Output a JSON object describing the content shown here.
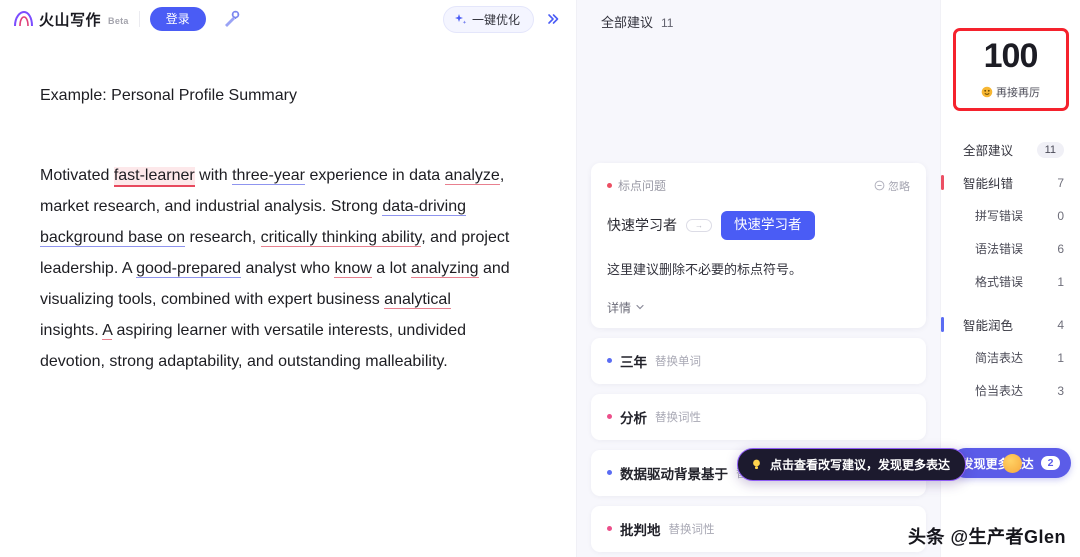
{
  "topbar": {
    "brand_name": "火山写作",
    "beta_label": "Beta",
    "login_label": "登录",
    "magic_icon": "magic-wand-icon",
    "optimize_label": "一键优化",
    "optimize_icon": "sparkle-icon",
    "collapse_icon": "double-chevron-right-icon"
  },
  "editor": {
    "title": "Example: Personal Profile Summary",
    "paragraph_parts": [
      {
        "text": "Motivated ",
        "mark": "none"
      },
      {
        "text": "fast-learner",
        "mark": "error-highlight"
      },
      {
        "text": " with ",
        "mark": "none"
      },
      {
        "text": "three-year",
        "mark": "style"
      },
      {
        "text": " experience in data ",
        "mark": "none"
      },
      {
        "text": "analyze",
        "mark": "error"
      },
      {
        "text": ", market research, and industrial analysis. Strong ",
        "mark": "none"
      },
      {
        "text": "data-driving background base on",
        "mark": "style"
      },
      {
        "text": " research, ",
        "mark": "none"
      },
      {
        "text": "critically thinking ability",
        "mark": "error"
      },
      {
        "text": ", and project leadership. A ",
        "mark": "none"
      },
      {
        "text": "good-prepared",
        "mark": "style"
      },
      {
        "text": " analyst who ",
        "mark": "none"
      },
      {
        "text": "know",
        "mark": "error"
      },
      {
        "text": " a lot ",
        "mark": "none"
      },
      {
        "text": "analyzing",
        "mark": "error"
      },
      {
        "text": " and visualizing tools, combined with expert business ",
        "mark": "none"
      },
      {
        "text": "analytical",
        "mark": "error"
      },
      {
        "text": " insights. ",
        "mark": "none"
      },
      {
        "text": "A",
        "mark": "error"
      },
      {
        "text": " aspiring learner with versatile interests, undivided devotion, strong adaptability, and outstanding malleability.",
        "mark": "none"
      }
    ]
  },
  "suggestions_panel": {
    "header_label": "全部建议",
    "header_count": "11",
    "card": {
      "tag": "标点问题",
      "tag_dot_color": "#ec4f63",
      "ignore_label": "忽略",
      "ignore_icon": "minus-circle-icon",
      "from_text": "快速学习者",
      "arrow_icon": "arrow-right-icon",
      "to_text": "快速学习者",
      "description": "这里建议删除不必要的标点符号。",
      "more_label": "详情",
      "more_icon": "chevron-down-icon"
    },
    "items": [
      {
        "word": "三年",
        "kind": "替换单词",
        "dot_color": "#5a6cf3"
      },
      {
        "word": "分析",
        "kind": "替换词性",
        "dot_color": "#ec4f8a"
      },
      {
        "word": "数据驱动背景基于",
        "kind": "替换",
        "dot_color": "#5a6cf3"
      },
      {
        "word": "批判地",
        "kind": "替换词性",
        "dot_color": "#ec4f8a"
      }
    ],
    "tooltip": {
      "text": "点击查看改写建议，发现更多表达",
      "icon": "lightbulb-icon"
    }
  },
  "score_panel": {
    "score": "100",
    "score_sub_label": "再接再厉",
    "score_sub_icon": "smiley-icon",
    "highlight_color": "#f5222d",
    "categories": [
      {
        "label": "全部建议",
        "count": "11",
        "style": "pill",
        "indent": "top",
        "bar": ""
      },
      {
        "label": "智能纠错",
        "count": "7",
        "style": "plain",
        "indent": "top",
        "bar": "#ec4f63"
      },
      {
        "label": "拼写错误",
        "count": "0",
        "style": "plain",
        "indent": "sub",
        "bar": ""
      },
      {
        "label": "语法错误",
        "count": "6",
        "style": "plain",
        "indent": "sub",
        "bar": ""
      },
      {
        "label": "格式错误",
        "count": "1",
        "style": "plain",
        "indent": "sub",
        "bar": ""
      },
      {
        "label": "智能润色",
        "count": "4",
        "style": "plain",
        "indent": "top",
        "bar": "#5a6cf3"
      },
      {
        "label": "简洁表达",
        "count": "1",
        "style": "plain",
        "indent": "sub",
        "bar": ""
      },
      {
        "label": "恰当表达",
        "count": "3",
        "style": "plain",
        "indent": "sub",
        "bar": ""
      }
    ],
    "discover_button": {
      "label": "发现更多表达",
      "badge": "2"
    }
  },
  "watermark": "头条 @生产者Glen"
}
